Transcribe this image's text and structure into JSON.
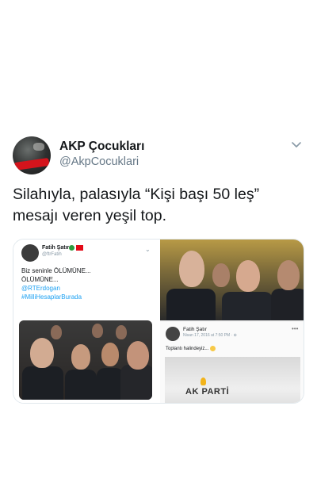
{
  "tweet": {
    "display_name": "AKP Çocukları",
    "handle": "@AkpCocuklari",
    "text_line1": "Silahıyla, palasıyla “Kişi başı 50 leş”",
    "text_line2": "mesajı veren yeşil top.",
    "menu_icon": "chevron-down-icon"
  },
  "media_left": {
    "author_name": "Fatih Şatır",
    "author_handle": "@ftrFatih",
    "more_label": "⌄",
    "line1": "Biz seninle ÖLÜMÜNE...",
    "line2": "ÖLÜMÜNE...",
    "mention": "@RTErdogan",
    "hashtag": "#MilliHesaplarBurada"
  },
  "media_right": {
    "post_author": "Fatih Şatır",
    "post_date": "Nisan 17, 2016 at 7:50 PM · ⊕",
    "post_more": "•••",
    "post_text": "Toplantı halindeyiz...",
    "sign_text": "AK PARTİ"
  },
  "colors": {
    "link": "#1da1f2",
    "secondary": "#657786",
    "text": "#14171a"
  }
}
